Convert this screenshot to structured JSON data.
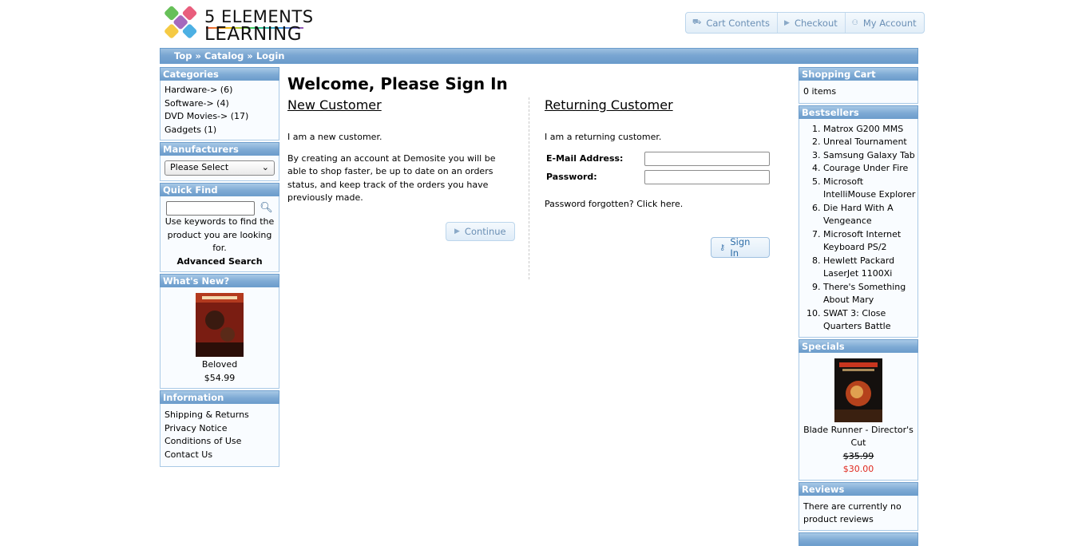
{
  "logo": {
    "line1": "5 ELEMENTS",
    "line2": "LEARNING"
  },
  "header_nav": [
    {
      "label": "Cart Contents",
      "icon": "cart-icon"
    },
    {
      "label": "Checkout",
      "icon": "triangle-right-icon"
    },
    {
      "label": "My Account",
      "icon": "person-icon"
    }
  ],
  "breadcrumb": {
    "text": "Top » Catalog » Login"
  },
  "categories": {
    "title": "Categories",
    "items": [
      "Hardware-> (6)",
      "Software-> (4)",
      "DVD Movies-> (17)",
      "Gadgets (1)"
    ]
  },
  "manufacturers": {
    "title": "Manufacturers",
    "selected": "Please Select"
  },
  "quick_find": {
    "title": "Quick Find",
    "help": "Use keywords to find the product you are looking for.",
    "advanced": "Advanced Search"
  },
  "whats_new": {
    "title": "What's New?",
    "product": "Beloved",
    "price": "$54.99"
  },
  "information": {
    "title": "Information",
    "items": [
      "Shipping & Returns",
      "Privacy Notice",
      "Conditions of Use",
      "Contact Us"
    ]
  },
  "main": {
    "heading": "Welcome, Please Sign In",
    "new_customer": {
      "title": "New Customer",
      "intro": "I am a new customer.",
      "body": "By creating an account at Demosite you will be able to shop faster, be up to date on an orders status, and keep track of the orders you have previously made.",
      "button": "Continue"
    },
    "returning_customer": {
      "title": "Returning Customer",
      "intro": "I am a returning customer.",
      "email_label": "E-Mail Address:",
      "password_label": "Password:",
      "forgot": "Password forgotten? Click here.",
      "button": "Sign In"
    }
  },
  "shopping_cart": {
    "title": "Shopping Cart",
    "content": "0 items"
  },
  "bestsellers": {
    "title": "Bestsellers",
    "items": [
      "Matrox G200 MMS",
      "Unreal Tournament",
      "Samsung Galaxy Tab",
      "Courage Under Fire",
      "Microsoft IntelliMouse Explorer",
      "Die Hard With A Vengeance",
      "Microsoft Internet Keyboard PS/2",
      "Hewlett Packard LaserJet 1100Xi",
      "There's Something About Mary",
      "SWAT 3: Close Quarters Battle"
    ]
  },
  "specials": {
    "title": "Specials",
    "product": "Blade Runner - Director's Cut",
    "old_price": "$35.99",
    "new_price": "$30.00"
  },
  "reviews": {
    "title": "Reviews",
    "text": "There are currently no product reviews"
  },
  "colors": {
    "accent": "#7aa6d2",
    "special_price": "#e0281e"
  }
}
